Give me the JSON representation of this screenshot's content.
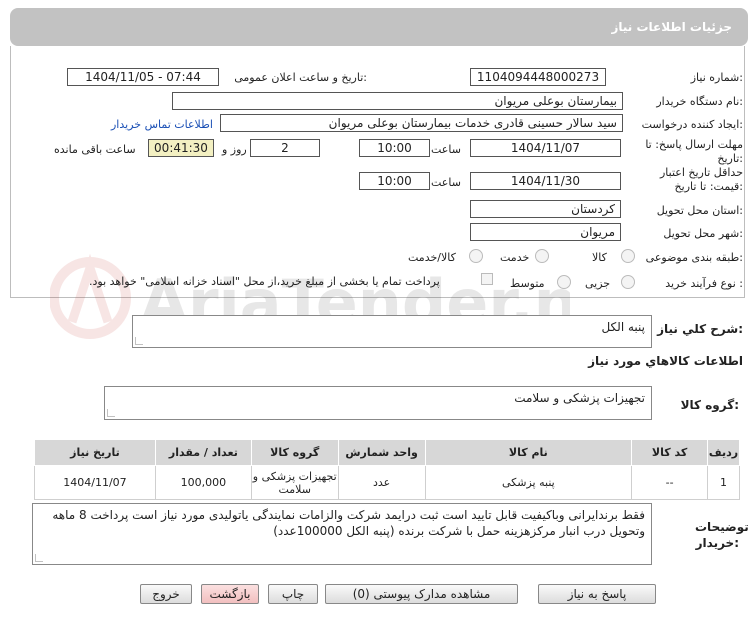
{
  "header": {
    "title": "جزئیات اطلاعات نیاز"
  },
  "fields": {
    "need_number_label": "شماره نیاز:",
    "need_number": "1104094448000273",
    "announce_label": "تاریخ و ساعت اعلان عمومی:",
    "announce_value": "1404/11/05 - 07:44",
    "buyer_org_label": "نام دستگاه خریدار:",
    "buyer_org": "بیمارستان بوعلی مریوان",
    "requester_label": "ایجاد کننده درخواست:",
    "requester": "سید سالار حسینی قادری خدمات بیمارستان بوعلی مریوان",
    "contact_link": "اطلاعات تماس خریدار",
    "deadline_label": "مهلت ارسال پاسخ: تا تاریخ:",
    "deadline_date": "1404/11/07",
    "time_label": "ساعت",
    "deadline_time": "10:00",
    "days_value": "2",
    "days_label": "روز و",
    "remaining_time": "00:41:30",
    "remaining_label": "ساعت باقی مانده",
    "validity_label": "حداقل تاریخ اعتبار قیمت: تا تاریخ:",
    "validity_date": "1404/11/30",
    "validity_time": "10:00",
    "province_label": "استان محل تحویل:",
    "province": "کردستان",
    "city_label": "شهر محل تحویل:",
    "city": "مریوان",
    "category_label": "طبقه بندی موضوعی:",
    "category_options": [
      "کالا",
      "خدمت",
      "کالا/خدمت"
    ],
    "process_label": "نوع فرآیند خرید :",
    "process_options": [
      "جزیی",
      "متوسط"
    ],
    "payment_note": "پرداخت تمام یا بخشی از مبلغ خرید،از محل \"اسناد خزانه اسلامی\" خواهد بود."
  },
  "summary": {
    "label": "شرح کلي نياز:",
    "value": "پنبه الکل"
  },
  "goods_info_title": "اطلاعات کالاهاي مورد نياز",
  "goods_group": {
    "label": "گروه کالا:",
    "value": "تجهیزات پزشکی و سلامت"
  },
  "table": {
    "headers": [
      "ردیف",
      "کد کالا",
      "نام کالا",
      "واحد شمارش",
      "گروه کالا",
      "تعداد / مقدار",
      "تاریخ نیاز"
    ],
    "rows": [
      [
        "1",
        "--",
        "پنبه پزشکی",
        "عدد",
        "تجهیزات پزشکی و سلامت",
        "100,000",
        "1404/11/07"
      ]
    ]
  },
  "buyer_notes": {
    "label": "توضیحات خریدار:",
    "value": "فقط برندایرانی وباکیفیت قابل تایید است ثبت درایمد شرکت والزامات نمایندگی یاتولیدی مورد نیاز است پرداخت 8 ماهه وتحویل درب انبار مرکزهزینه حمل با شرکت برنده (پنبه الکل 100000عدد)"
  },
  "buttons": {
    "reply": "پاسخ به نیاز",
    "attachments": "مشاهده مدارک پیوستی (0)",
    "print": "چاپ",
    "back": "بازگشت",
    "exit": "خروج"
  },
  "watermark": {
    "text": "AriaTender.neT"
  },
  "colors": {
    "header_bg": "#c2c2c2",
    "remaining_bg": "#f3f0c2",
    "link": "#1a4fb5",
    "back_btn": "#f7c9c9"
  }
}
